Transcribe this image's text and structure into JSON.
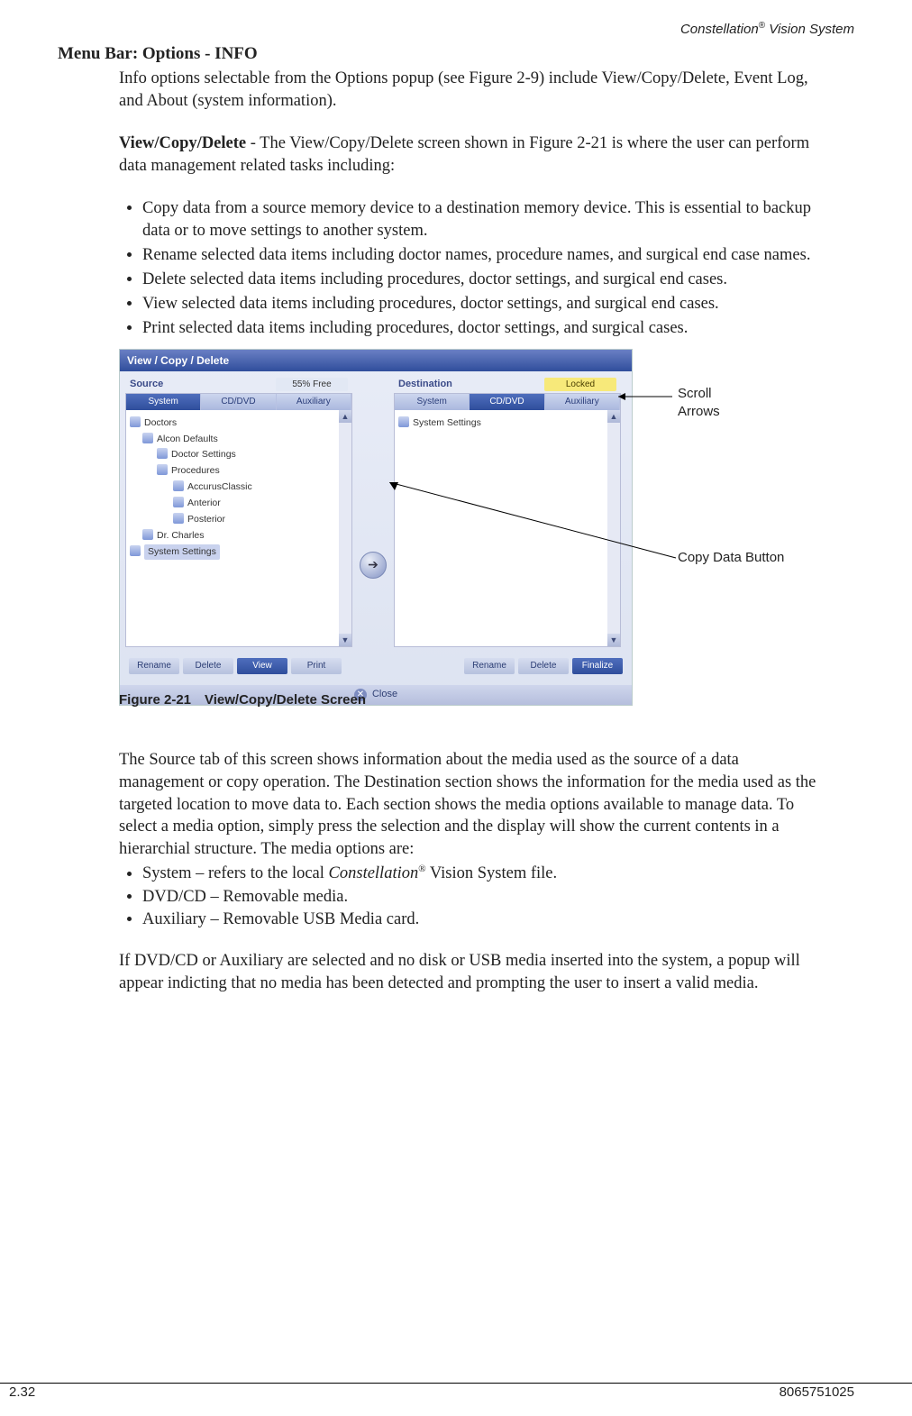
{
  "header": {
    "product": "Constellation",
    "reg": "®",
    "suffix": " Vision System"
  },
  "title": "Menu Bar: Options - INFO",
  "intro": "Info options selectable from the Options popup (see Figure 2-9) include View/Copy/Delete, Event Log, and About (system information).",
  "vcd_label": "View/Copy/Delete",
  "vcd_text": " - The View/Copy/Delete screen shown in Figure 2-21 is where the user can perform data management related tasks including:",
  "bullets1": [
    "Copy data from a source memory device to a destination memory device. This is essential to backup data or to move settings to another system.",
    "Rename selected data items including doctor names, procedure names, and surgical end case names.",
    "Delete selected data items including procedures, doctor settings, and surgical end cases.",
    "View selected data items including procedures, doctor settings, and surgical end cases.",
    "Print selected data items including procedures, doctor settings, and surgical cases."
  ],
  "figure": {
    "window_title": "View / Copy / Delete",
    "source_label": "Source",
    "dest_label": "Destination",
    "free": "55% Free",
    "locked": "Locked",
    "tabs": [
      "System",
      "CD/DVD",
      "Auxiliary"
    ],
    "source_tree": [
      "Doctors",
      "Alcon Defaults",
      "Doctor Settings",
      "Procedures",
      "AccurusClassic",
      "Anterior",
      "Posterior",
      "Dr. Charles",
      "System Settings"
    ],
    "dest_tree": [
      "System Settings"
    ],
    "src_buttons": [
      "Rename",
      "Delete",
      "View",
      "Print"
    ],
    "dst_buttons": [
      "Rename",
      "Delete",
      "Finalize"
    ],
    "close": "Close",
    "caption": "Figure 2-21 View/Copy/Delete Screen"
  },
  "callout_scroll": "Scroll Arrows",
  "callout_copy": "Copy Data Button",
  "para2": "The Source tab of this screen shows information about the media used as the source of a data management or copy operation. The Destination section shows the information for the media used as the targeted location to move data to. Each section shows the media options available to manage data. To select a media option, simply press the selection and the display will show the current contents in a hierarchial structure. The media options are:",
  "media": {
    "system_prefix": "System – refers to the local ",
    "system_name": "Constellation",
    "system_reg": "®",
    "system_suffix": " Vision System file.",
    "dvd": "DVD/CD – Removable media.",
    "aux": "Auxiliary – Removable USB Media card."
  },
  "para3": "If DVD/CD or Auxiliary are selected and no disk or USB media inserted into the system, a popup will appear indicting that no media has been detected and prompting the user to insert a valid media.",
  "footer": {
    "left": "2.32",
    "right": "8065751025"
  }
}
